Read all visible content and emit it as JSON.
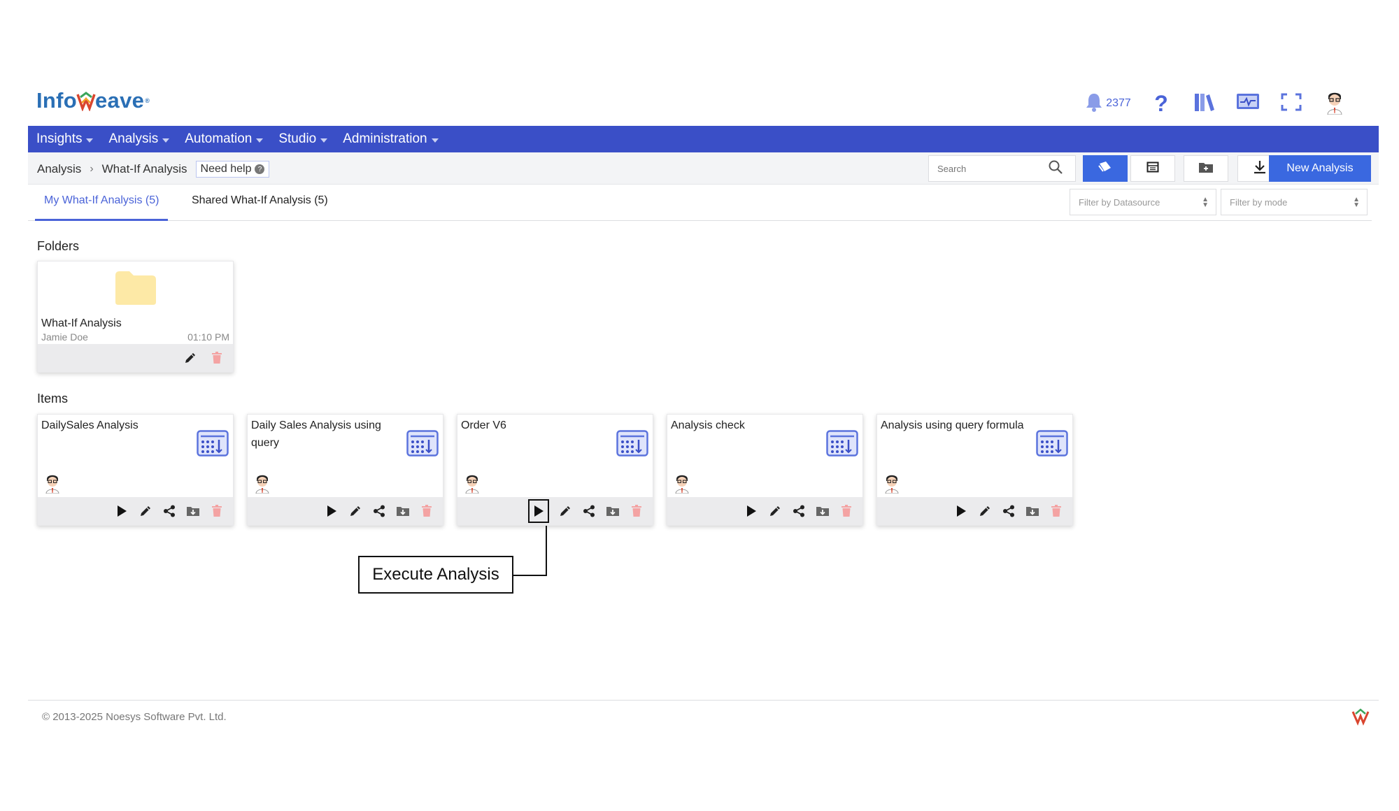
{
  "brand": {
    "part1": "Info",
    "part2": "eave"
  },
  "header": {
    "notification_count": "2377"
  },
  "nav": {
    "items": [
      {
        "label": "Insights"
      },
      {
        "label": "Analysis"
      },
      {
        "label": "Automation"
      },
      {
        "label": "Studio"
      },
      {
        "label": "Administration"
      }
    ]
  },
  "breadcrumb": {
    "items": [
      "Analysis",
      "What-If Analysis"
    ],
    "need_help": "Need help"
  },
  "search": {
    "placeholder": "Search"
  },
  "toolbar": {
    "new_label": "New Analysis"
  },
  "tabs": [
    {
      "label": "My What-If Analysis (5)",
      "active": true
    },
    {
      "label": "Shared What-If Analysis (5)",
      "active": false
    }
  ],
  "filters": {
    "datasource": "Filter by Datasource",
    "mode": "Filter by mode"
  },
  "sections": {
    "folders": "Folders",
    "items": "Items"
  },
  "folders": [
    {
      "name": "What-If Analysis",
      "owner": "Jamie Doe",
      "time": "01:10 PM"
    }
  ],
  "items": [
    {
      "name": "DailySales Analysis"
    },
    {
      "name": "Daily Sales Analysis using query"
    },
    {
      "name": "Order V6"
    },
    {
      "name": "Analysis check"
    },
    {
      "name": "Analysis using query formula"
    }
  ],
  "annotation": {
    "label": "Execute Analysis"
  },
  "footer": {
    "copyright": "© 2013-2025 Noesys Software Pvt. Ltd."
  },
  "colors": {
    "nav": "#3a4fc7",
    "accent": "#3a68e0",
    "link": "#4a63d8",
    "folder": "#fde9a6",
    "delete": "#f4a3a3"
  }
}
